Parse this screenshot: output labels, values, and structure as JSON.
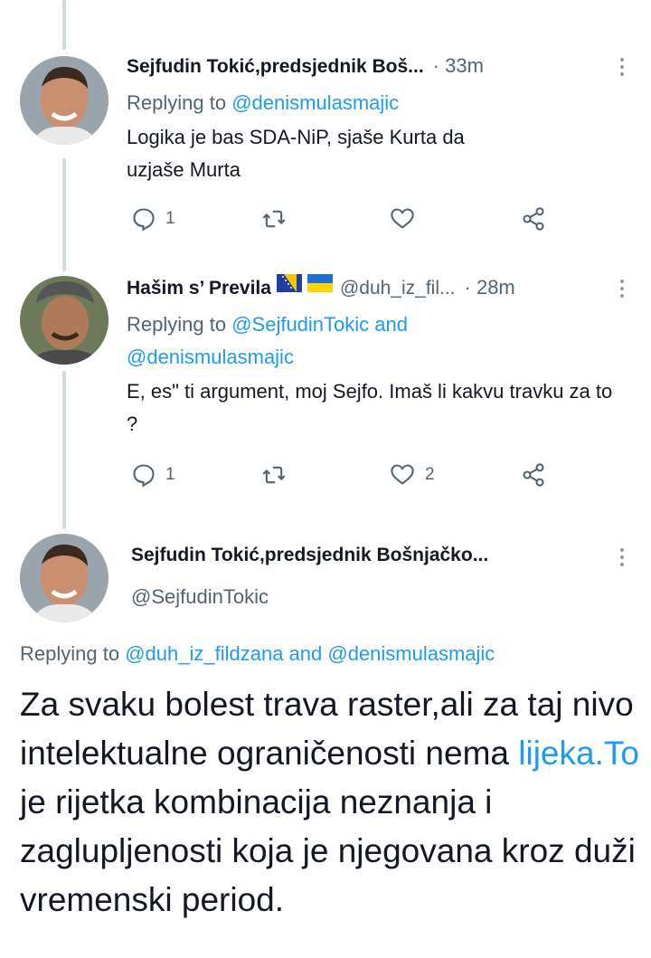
{
  "thread": [
    {
      "name": "Sejfudin Tokić,predsjednik Boš...",
      "handle": "",
      "time": "· 33m",
      "replying_label": "Replying to",
      "replying_to": "@denismulasmajic",
      "replying_to_2": "",
      "text": "Logika je bas SDA-NiP, sjaše Kurta da uzjaše Murta",
      "reply_count": "1",
      "retweet_count": "",
      "like_count": ""
    },
    {
      "name": "Hašim s’ Previla",
      "handle": "@duh_iz_fil...",
      "time": "· 28m",
      "replying_label": "Replying to",
      "replying_to": "@SejfudinTokic and",
      "replying_to_2": "@denismulasmajic",
      "text": "E, es\" ti argument, moj Sejfo. Imaš li kakvu travku za to ?",
      "reply_count": "1",
      "retweet_count": "",
      "like_count": "2"
    }
  ],
  "main_tweet": {
    "name": "Sejfudin Tokić,predsjednik Bošnjačko...",
    "handle": "@SejfudinTokic",
    "replying_label": "Replying to",
    "replying_to": "@duh_iz_fildzana and @denismulasmajic",
    "text_part1": "Za svaku bolest trava raster,ali za taj nivo intelektualne ograničenosti nema ",
    "text_link": "lijeka.To",
    "text_part2": " je rijetka kombinacija neznanja i zaglupljenosti koja je njegovana kroz duži vremenski period."
  },
  "icons": {
    "reply": "reply-icon",
    "retweet": "retweet-icon",
    "like": "heart-icon",
    "share": "share-icon",
    "more": "more-icon"
  },
  "colors": {
    "link": "#1d9bf0",
    "secondary": "#536471",
    "thread_line": "#cfd9de"
  }
}
